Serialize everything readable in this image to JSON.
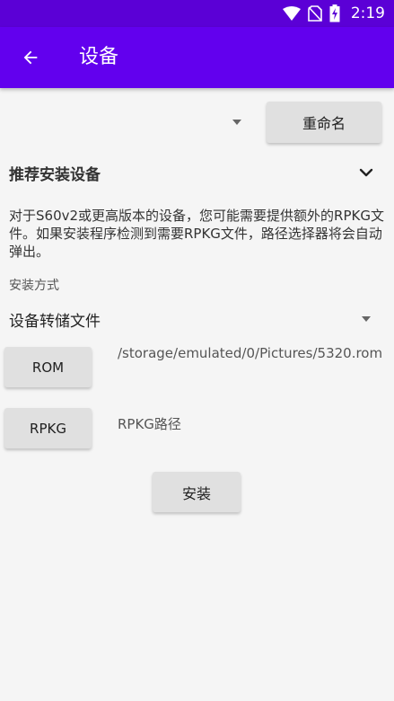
{
  "status_bar": {
    "time": "2:19",
    "background": "#5b00d6",
    "icons": [
      "wifi-icon",
      "no-sim-icon",
      "battery-charging-icon"
    ]
  },
  "app_bar": {
    "title": "设备",
    "background": "#6200ee",
    "back_icon": "arrow-back-icon"
  },
  "device": {
    "selected": "",
    "rename_label": "重命名"
  },
  "recommended": {
    "title": "推荐安装设备",
    "expanded": true,
    "description": "对于S60v2或更高版本的设备，您可能需要提供额外的RPKG文件。如果安装程序检测到需要RPKG文件，路径选择器将会自动弹出。"
  },
  "install_method": {
    "label": "安装方式",
    "selected": "设备转储文件"
  },
  "rom": {
    "button_label": "ROM",
    "path": "/storage/emulated/0/Pictures/5320.rom"
  },
  "rpkg": {
    "button_label": "RPKG",
    "path": "RPKG路径"
  },
  "install": {
    "button_label": "安装"
  }
}
